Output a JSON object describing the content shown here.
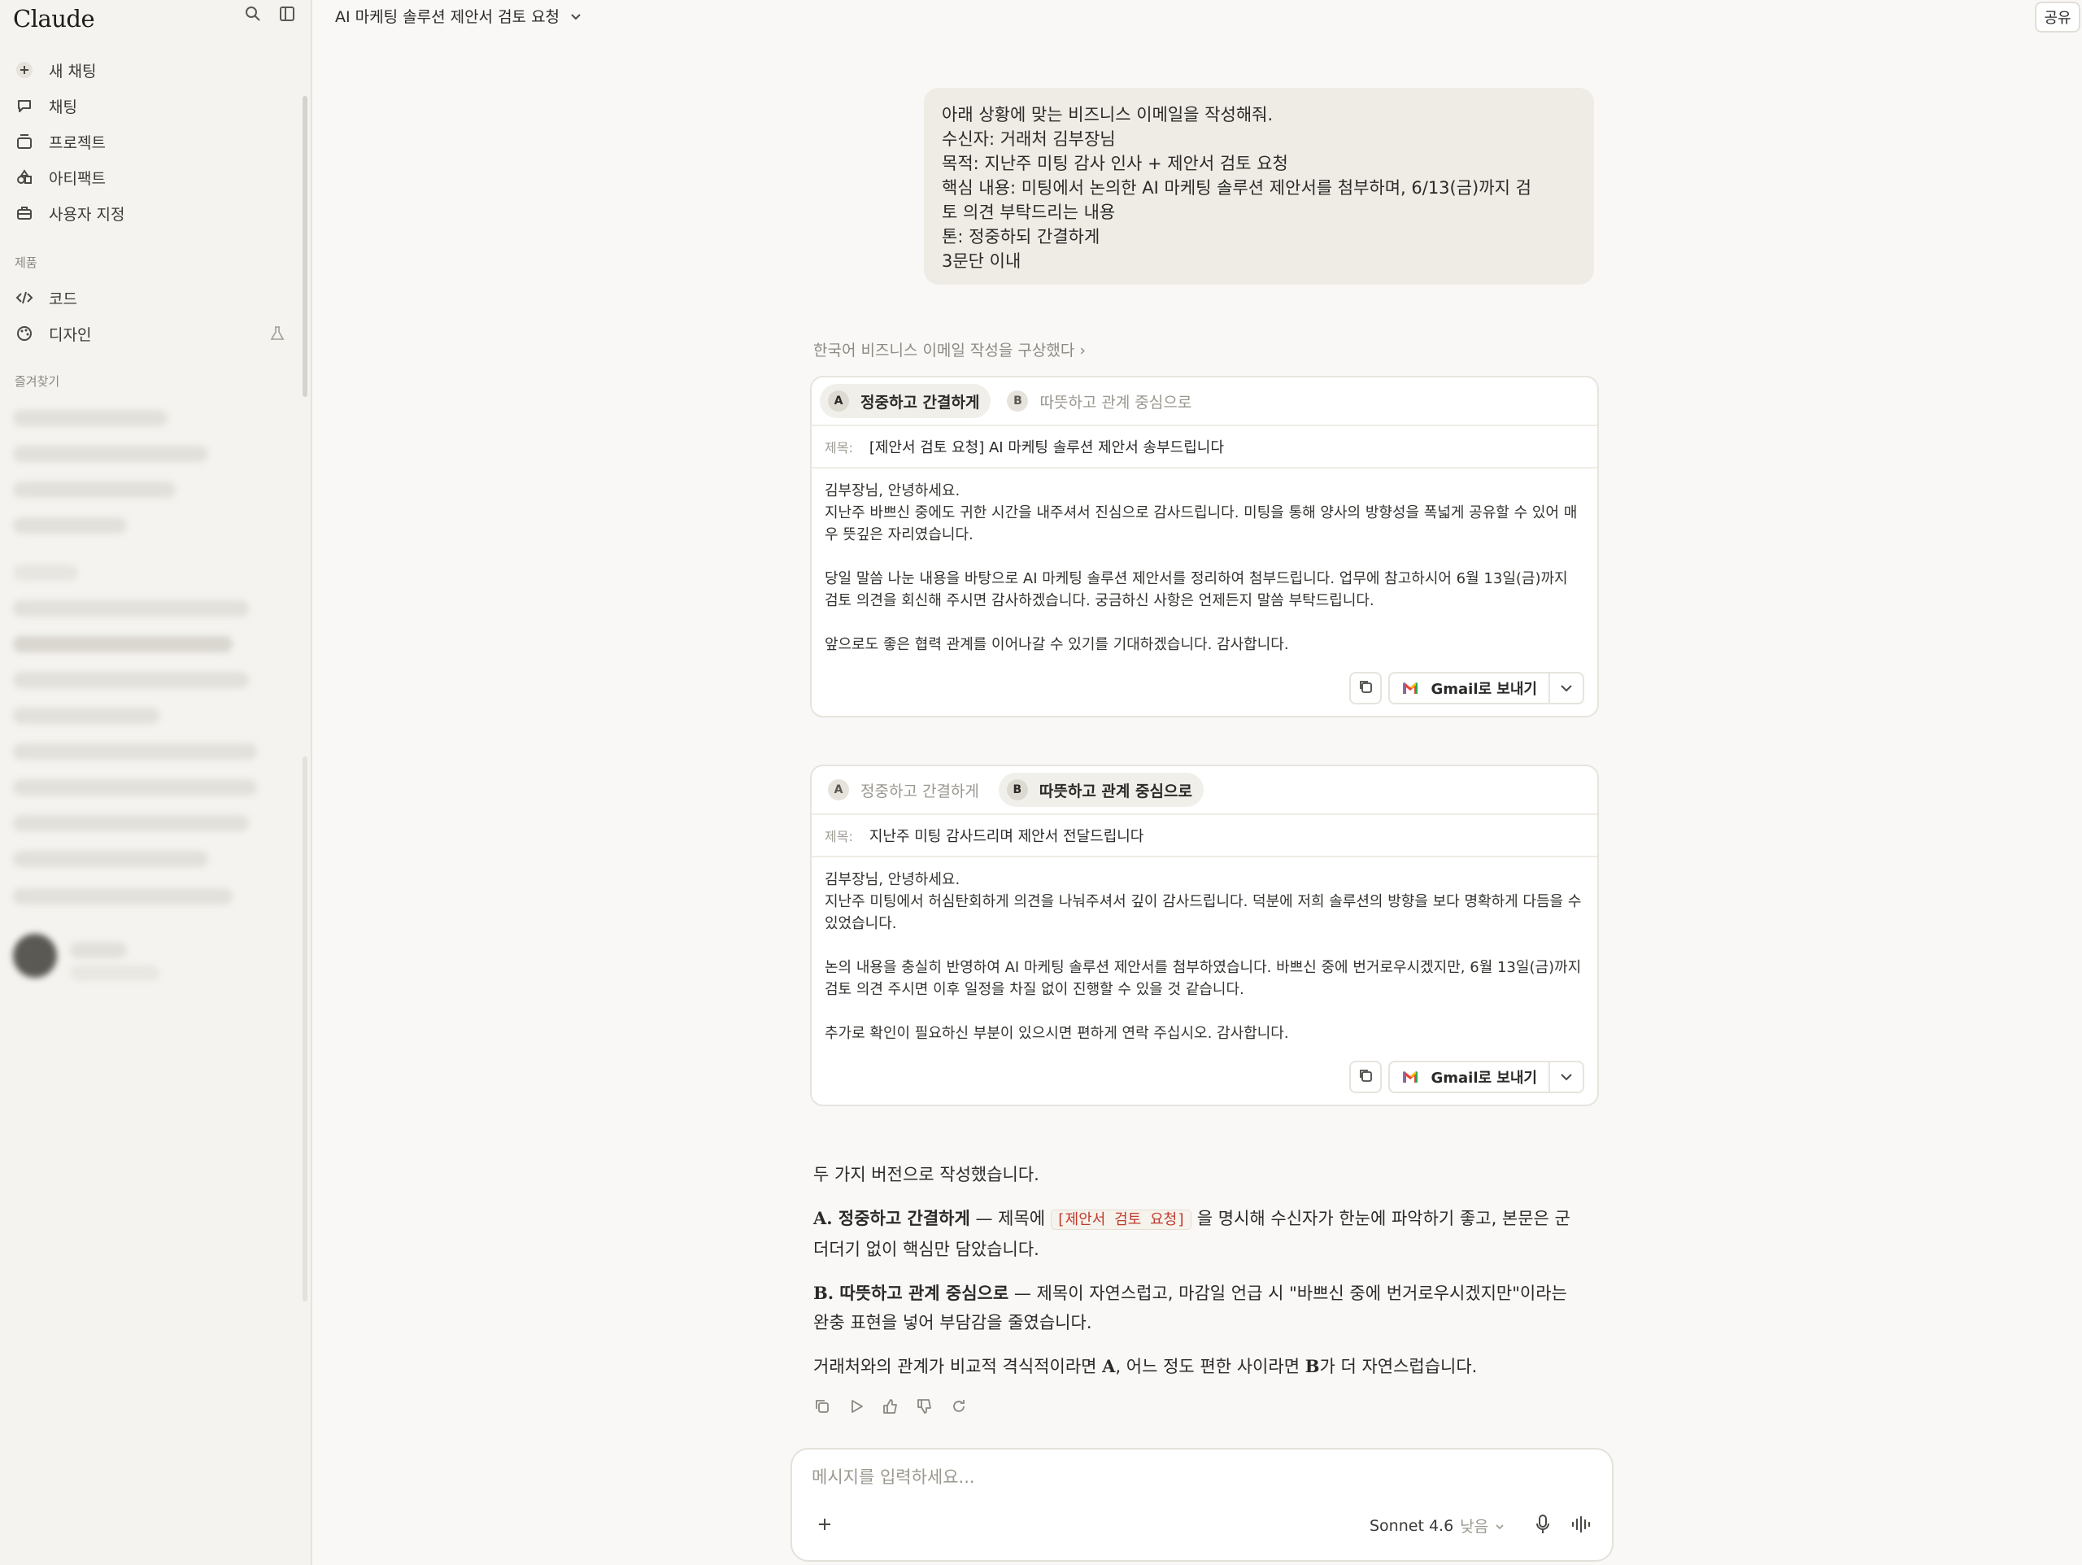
{
  "sidebar": {
    "logo": "Claude",
    "nav": [
      {
        "label": "새 채팅",
        "icon": "plus-icon"
      },
      {
        "label": "채팅",
        "icon": "chat-icon"
      },
      {
        "label": "프로젝트",
        "icon": "folder-icon"
      },
      {
        "label": "아티팩트",
        "icon": "artifact-icon"
      },
      {
        "label": "사용자 지정",
        "icon": "briefcase-icon"
      }
    ],
    "section_products": "제품",
    "products": [
      {
        "label": "코드",
        "icon": "code-icon"
      },
      {
        "label": "디자인",
        "icon": "palette-icon"
      }
    ],
    "section_favorites": "즐겨찾기"
  },
  "header": {
    "title": "AI 마케팅 솔루션 제안서 검토 요청",
    "share_label": "공유"
  },
  "user_message": {
    "lines": [
      "아래 상황에 맞는 비즈니스 이메일을 작성해줘.",
      "수신자: 거래처 김부장님",
      "목적: 지난주 미팅 감사 인사 + 제안서 검토 요청",
      "핵심 내용: 미팅에서 논의한 AI 마케팅 솔루션 제안서를 첨부하며, 6/13(금)까지 검",
      "토 의견 부탁드리는 내용",
      "톤: 정중하되 간결하게",
      "3문단 이내"
    ]
  },
  "thinking_label": "한국어 비즈니스 이메일 작성을 구상했다 ›",
  "cards": [
    {
      "tab_a_badge": "A",
      "tab_a_label": "정중하고 간결하게",
      "tab_b_badge": "B",
      "tab_b_label": "따뜻하고 관계 중심으로",
      "subject_label": "제목:",
      "subject": "[제안서 검토 요청] AI 마케팅 솔루션 제안서 송부드립니다",
      "p1": "김부장님, 안녕하세요.\n지난주 바쁘신 중에도 귀한 시간을 내주셔서 진심으로 감사드립니다. 미팅을 통해 양사의 방향성을 폭넓게 공유할 수 있어 매우 뜻깊은 자리였습니다.",
      "p2": "당일 말씀 나눈 내용을 바탕으로 AI 마케팅 솔루션 제안서를 정리하여 첨부드립니다. 업무에 참고하시어 6월 13일(금)까지 검토 의견을 회신해 주시면 감사하겠습니다. 궁금하신 사항은 언제든지 말씀 부탁드립니다.",
      "p3": "앞으로도 좋은 협력 관계를 이어나갈 수 있기를 기대하겠습니다. 감사합니다.",
      "gmail_label": "Gmail로 보내기"
    },
    {
      "tab_a_badge": "A",
      "tab_a_label": "정중하고 간결하게",
      "tab_b_badge": "B",
      "tab_b_label": "따뜻하고 관계 중심으로",
      "subject_label": "제목:",
      "subject": "지난주 미팅 감사드리며 제안서 전달드립니다",
      "p1": "김부장님, 안녕하세요.\n지난주 미팅에서 허심탄회하게 의견을 나눠주셔서 깊이 감사드립니다. 덕분에 저희 솔루션의 방향을 보다 명확하게 다듬을 수 있었습니다.",
      "p2": "논의 내용을 충실히 반영하여 AI 마케팅 솔루션 제안서를 첨부하였습니다. 바쁘신 중에 번거로우시겠지만, 6월 13일(금)까지 검토 의견 주시면 이후 일정을 차질 없이 진행할 수 있을 것 같습니다.",
      "p3": "추가로 확인이 필요하신 부분이 있으시면 편하게 연락 주십시오. 감사합니다.",
      "gmail_label": "Gmail로 보내기"
    }
  ],
  "assistant": {
    "intro": "두 가지 버전으로 작성했습니다.",
    "a_title": "A. 정중하고 간결하게",
    "a_pre": " — 제목에 ",
    "a_code": "[제안서 검토 요청]",
    "a_post": " 을 명시해 수신자가 한눈에 파악하기 좋고, 본문은 군더더기 없이 핵심만 담았습니다.",
    "b_title": "B. 따뜻하고 관계 중심으로",
    "b_text": " — 제목이 자연스럽고, 마감일 언급 시 \"바쁘신 중에 번거로우시겠지만\"이라는 완충 표현을 넣어 부담감을 줄였습니다.",
    "c_pre": "거래처와의 관계가 비교적 격식적이라면 ",
    "c_a": "A",
    "c_mid": ", 어느 정도 편한 사이라면 ",
    "c_b": "B",
    "c_post": "가 더 자연스럽습니다."
  },
  "composer": {
    "placeholder": "메시지를 입력하세요...",
    "model": "Sonnet 4.6",
    "effort": "낮음"
  }
}
